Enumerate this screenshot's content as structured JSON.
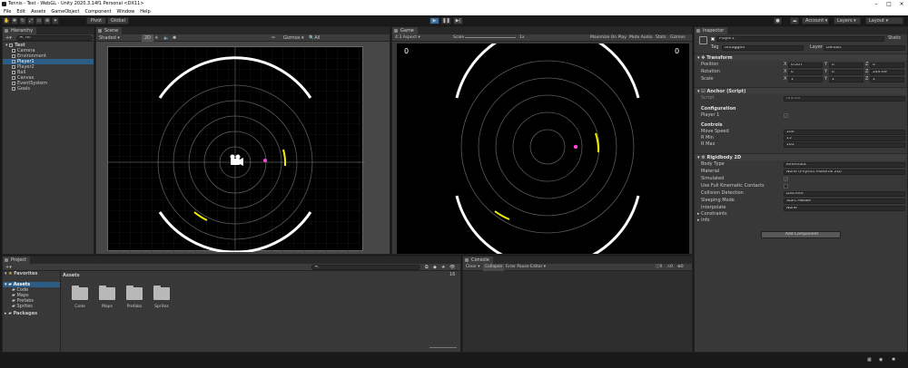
{
  "window": {
    "title": "Tennis - Test - WebGL - Unity 2020.3.14f1 Personal <DX11>"
  },
  "menu": [
    "File",
    "Edit",
    "Assets",
    "GameObject",
    "Component",
    "Window",
    "Help"
  ],
  "toolbar": {
    "pivot": "Pivot",
    "global": "Global",
    "account": "Account",
    "layers": "Layers",
    "layout": "Layout"
  },
  "hierarchy": {
    "tab": "Hierarchy",
    "search": "All",
    "items": [
      {
        "label": "Test",
        "level": 0,
        "selected": false
      },
      {
        "label": "Camera",
        "level": 1,
        "selected": false
      },
      {
        "label": "Environment",
        "level": 1,
        "selected": false
      },
      {
        "label": "Player1",
        "level": 1,
        "selected": true
      },
      {
        "label": "Player2",
        "level": 1,
        "selected": false
      },
      {
        "label": "Ball",
        "level": 1,
        "selected": false
      },
      {
        "label": "Canvas",
        "level": 1,
        "selected": false
      },
      {
        "label": "EventSystem",
        "level": 1,
        "selected": false
      },
      {
        "label": "Goals",
        "level": 1,
        "selected": false
      }
    ]
  },
  "scene": {
    "tab": "Scene",
    "shading": "Shaded",
    "mode": "2D",
    "gizmos": "Gizmos",
    "search": "All"
  },
  "game": {
    "tab": "Game",
    "display": "Display 1",
    "aspect": "4:3 Aspect",
    "scale_label": "Scale",
    "scale_value": "1x",
    "maximize": "Maximize On Play",
    "mute": "Mute Audio",
    "stats": "Stats",
    "gizmos": "Gizmos",
    "score_left": "0",
    "score_right": "0"
  },
  "inspector": {
    "tab": "Inspector",
    "object_name": "Player1",
    "static": "Static",
    "tag_label": "Tag",
    "tag": "Untagged",
    "layer_label": "Layer",
    "layer": "Default",
    "transform": {
      "title": "Transform",
      "rows": [
        {
          "label": "Position",
          "x": "0.007",
          "y": "0",
          "z": "0"
        },
        {
          "label": "Rotation",
          "x": "0",
          "y": "0",
          "z": "149.69"
        },
        {
          "label": "Scale",
          "x": "1",
          "y": "1",
          "z": "1"
        }
      ]
    },
    "anchor": {
      "title": "Anchor (Script)",
      "script_label": "Script",
      "script": "Anchor",
      "configuration": "Configuration",
      "player1": "Player 1",
      "controls": "Controls",
      "rows": [
        {
          "label": "Move Speed",
          "value": "100"
        },
        {
          "label": "R Min",
          "value": "15"
        },
        {
          "label": "R Max",
          "value": "165"
        }
      ]
    },
    "rigidbody": {
      "title": "Rigidbody 2D",
      "rows": [
        {
          "label": "Body Type",
          "value": "Kinematic"
        },
        {
          "label": "Material",
          "value": "None (Physics Material 2D)"
        },
        {
          "label": "Simulated",
          "value": ""
        },
        {
          "label": "Use Full Kinematic Contacts",
          "value": ""
        },
        {
          "label": "Collision Detection",
          "value": "Discrete"
        },
        {
          "label": "Sleeping Mode",
          "value": "Start Awake"
        },
        {
          "label": "Interpolate",
          "value": "None"
        }
      ],
      "constraints": "Constraints",
      "info": "Info"
    },
    "add_component": "Add Component"
  },
  "project": {
    "tab": "Project",
    "favorites": "Favorites",
    "assets": "Assets",
    "packages": "Packages",
    "tree": [
      "Code",
      "Maps",
      "Prefabs",
      "Sprites"
    ],
    "breadcrumb": "Assets",
    "folders": [
      "Code",
      "Maps",
      "Prefabs",
      "Sprites"
    ],
    "count": "16"
  },
  "console": {
    "tab": "Console",
    "clear": "Clear",
    "collapse": "Collapse",
    "error_pause": "Error Pause",
    "editor": "Editor",
    "c0": "0",
    "c1": "0",
    "c2": "0"
  },
  "colors": {
    "selection": "#2c5d87",
    "paddle": "#f0f000",
    "ball": "#ff44dd"
  }
}
